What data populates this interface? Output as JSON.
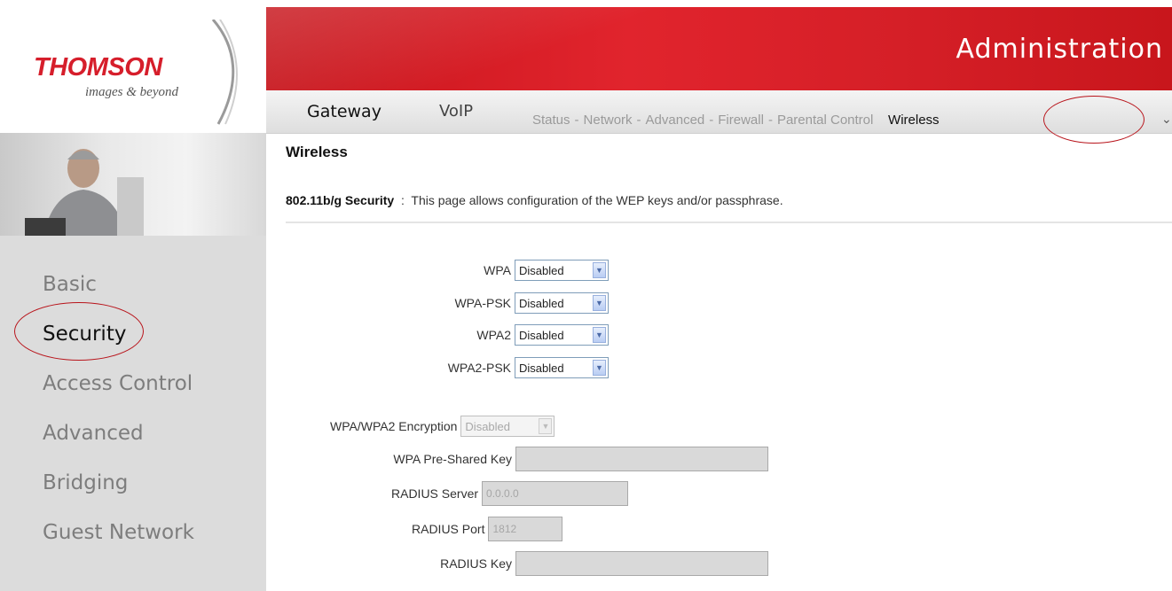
{
  "brand": {
    "name": "THOMSON",
    "tagline": "images & beyond"
  },
  "header": {
    "title": "Administration"
  },
  "nav": {
    "main": [
      "Gateway",
      "VoIP"
    ],
    "sub": [
      "Status",
      "Network",
      "Advanced",
      "Firewall",
      "Parental Control",
      "Wireless"
    ],
    "separator": "-",
    "active_sub": "Wireless"
  },
  "sidebar": {
    "items": [
      {
        "label": "Basic",
        "active": false
      },
      {
        "label": "Security",
        "active": true
      },
      {
        "label": "Access Control",
        "active": false
      },
      {
        "label": "Advanced",
        "active": false
      },
      {
        "label": "Bridging",
        "active": false
      },
      {
        "label": "Guest Network",
        "active": false
      }
    ]
  },
  "page": {
    "title": "Wireless",
    "section": "802.11b/g Security",
    "colon": ":",
    "description": "This page allows configuration of the WEP keys and/or passphrase."
  },
  "form": {
    "wpa": {
      "label": "WPA",
      "value": "Disabled"
    },
    "wpa_psk": {
      "label": "WPA-PSK",
      "value": "Disabled"
    },
    "wpa2": {
      "label": "WPA2",
      "value": "Disabled"
    },
    "wpa2_psk": {
      "label": "WPA2-PSK",
      "value": "Disabled"
    },
    "encryption": {
      "label": "WPA/WPA2 Encryption",
      "value": "Disabled"
    },
    "psk": {
      "label": "WPA Pre-Shared Key",
      "value": ""
    },
    "radius_server": {
      "label": "RADIUS Server",
      "value": "0.0.0.0"
    },
    "radius_port": {
      "label": "RADIUS Port",
      "value": "1812"
    },
    "radius_key": {
      "label": "RADIUS Key",
      "value": ""
    }
  },
  "colors": {
    "brand_red": "#d61e2b",
    "highlight_ring": "#b8141b",
    "sidebar_bg": "#dcdcdc"
  }
}
